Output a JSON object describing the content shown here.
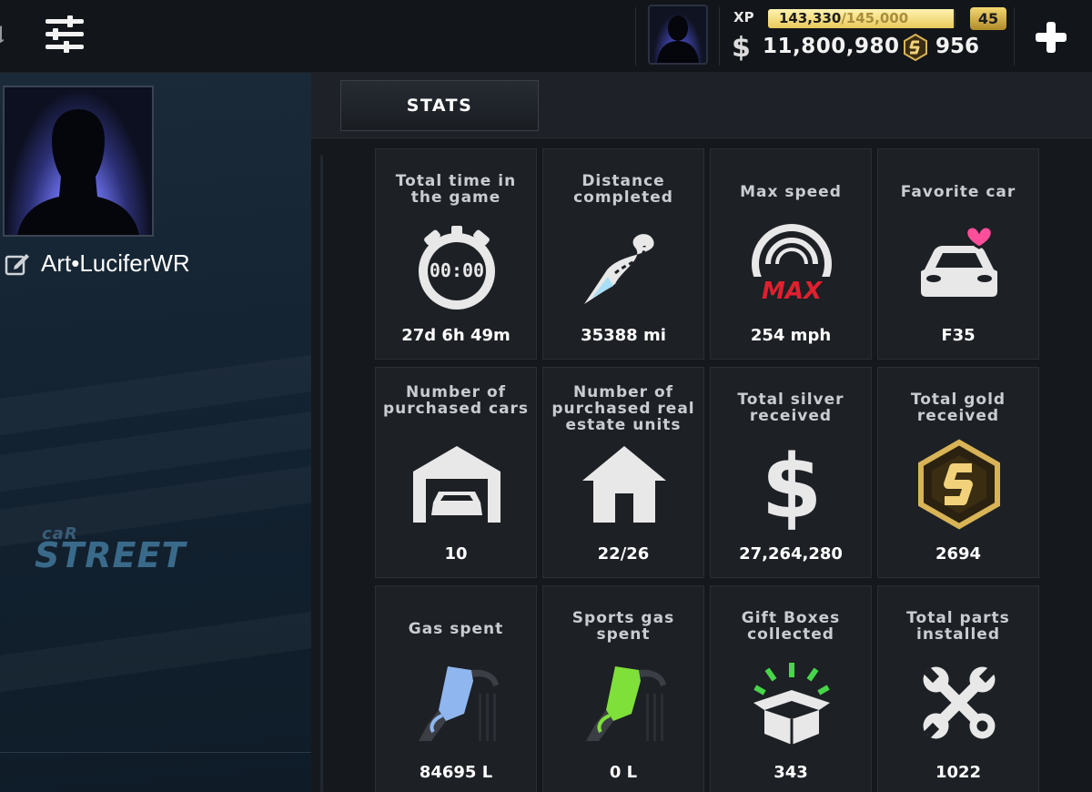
{
  "header": {
    "xp_label": "XP",
    "xp_current": "143,330",
    "xp_max": "/145,000",
    "xp_progress": 0.9885,
    "level": "45",
    "silver_symbol": "$",
    "silver_amount": "11,800,980",
    "gold_amount": "956"
  },
  "profile": {
    "username": "Art•LuciferWR"
  },
  "logo": {
    "small": "caR",
    "big": "STREET"
  },
  "tabs": {
    "stats": "STATS"
  },
  "stats": [
    {
      "title": "Total time in the game",
      "value": "27d 6h 49m",
      "icon": "stopwatch-icon",
      "icon_text": "00:00"
    },
    {
      "title": "Distance completed",
      "value": "35388 mi",
      "icon": "road-icon"
    },
    {
      "title": "Max speed",
      "value": "254 mph",
      "icon": "speedometer-icon",
      "icon_text": "MAX"
    },
    {
      "title": "Favorite car",
      "value": "F35",
      "icon": "car-heart-icon"
    },
    {
      "title": "Number of purchased cars",
      "value": "10",
      "icon": "garage-icon"
    },
    {
      "title": "Number of purchased real estate units",
      "value": "22/26",
      "icon": "house-icon"
    },
    {
      "title": "Total silver received",
      "value": "27,264,280",
      "icon": "silver-dollar-icon",
      "icon_text": "$"
    },
    {
      "title": "Total gold received",
      "value": "2694",
      "icon": "gold-coin-icon"
    },
    {
      "title": "Gas spent",
      "value": "84695 L",
      "icon": "gas-nozzle-blue-icon"
    },
    {
      "title": "Sports gas spent",
      "value": "0 L",
      "icon": "gas-nozzle-green-icon"
    },
    {
      "title": "Gift Boxes collected",
      "value": "343",
      "icon": "gift-box-icon"
    },
    {
      "title": "Total parts installed",
      "value": "1022",
      "icon": "wrenches-icon"
    }
  ],
  "colors": {
    "accent_gold": "#e9c95a",
    "heart_pink": "#ff4f9a",
    "max_red": "#e0202e",
    "gas_blue": "#8fb6ee",
    "gas_green": "#7fe03a",
    "gift_green": "#47d64a"
  }
}
